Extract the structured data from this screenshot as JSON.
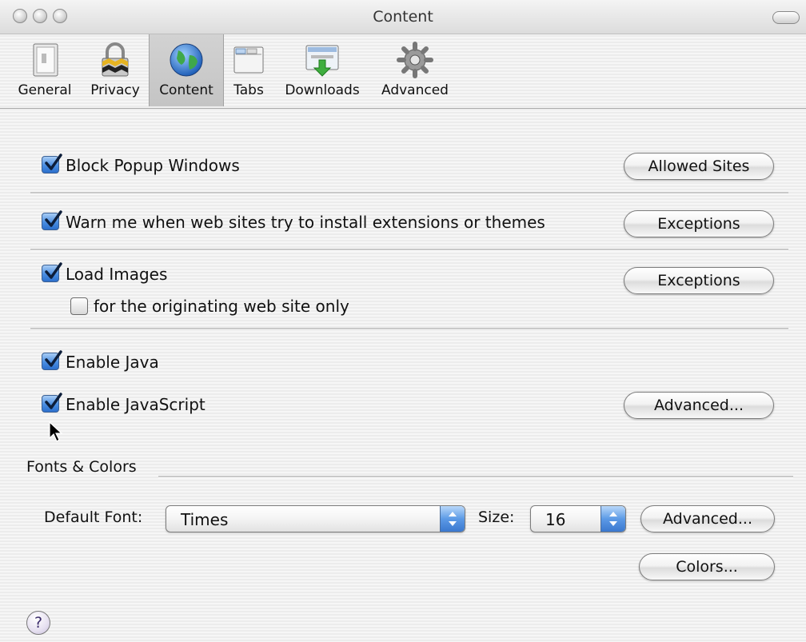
{
  "window": {
    "title": "Content"
  },
  "toolbar": {
    "items": [
      {
        "label": "General",
        "icon": "general-switch-icon"
      },
      {
        "label": "Privacy",
        "icon": "lock-icon"
      },
      {
        "label": "Content",
        "icon": "globe-icon",
        "selected": true
      },
      {
        "label": "Tabs",
        "icon": "tabs-window-icon"
      },
      {
        "label": "Downloads",
        "icon": "download-icon"
      },
      {
        "label": "Advanced",
        "icon": "gear-icon"
      }
    ]
  },
  "content": {
    "block_popups": {
      "label": "Block Popup Windows",
      "checked": true,
      "button": "Allowed Sites"
    },
    "warn_extensions": {
      "label": "Warn me when web sites try to install extensions or themes",
      "checked": true,
      "button": "Exceptions"
    },
    "load_images": {
      "label": "Load Images",
      "checked": true,
      "button": "Exceptions"
    },
    "originating_only": {
      "label": "for the originating web site only",
      "checked": false
    },
    "enable_java": {
      "label": "Enable Java",
      "checked": true
    },
    "enable_javascript": {
      "label": "Enable JavaScript",
      "checked": true,
      "button": "Advanced..."
    }
  },
  "fonts_colors": {
    "section_title": "Fonts & Colors",
    "default_font_label": "Default Font:",
    "default_font_value": "Times",
    "size_label": "Size:",
    "size_value": "16",
    "advanced_button": "Advanced...",
    "colors_button": "Colors..."
  },
  "help": {
    "glyph": "?"
  },
  "colors": {
    "accent_blue": "#2c6fcc",
    "window_bg": "#ececec"
  }
}
